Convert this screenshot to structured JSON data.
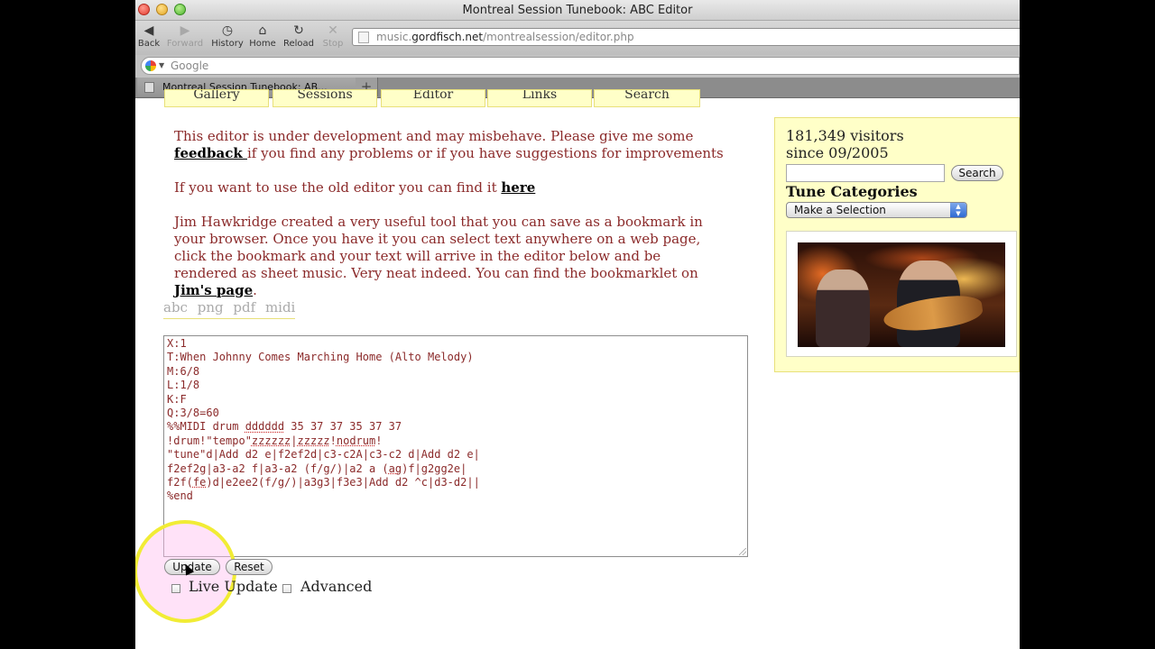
{
  "window": {
    "title": "Montreal Session Tunebook: ABC Editor"
  },
  "toolbar": {
    "back": "Back",
    "forward": "Forward",
    "history": "History",
    "home": "Home",
    "reload": "Reload",
    "stop": "Stop"
  },
  "address": {
    "prefix": "music.",
    "domain": "gordfisch.net",
    "path": "/montrealsession/editor.php"
  },
  "search_bar": {
    "placeholder": "Google"
  },
  "tabs": [
    {
      "label": "Montreal Session Tunebook: AB..."
    }
  ],
  "nav": {
    "gallery": "Gallery",
    "sessions": "Sessions",
    "editor": "Editor",
    "links": "Links",
    "search": "Search"
  },
  "intro": {
    "p1_text": "This editor is under development and may misbehave. Please give me some",
    "p1_link": "feedback ",
    "p1_tail": "if you find any problems or if you have suggestions for improvements",
    "p2_text": "If you want to use the old editor you can find it ",
    "p2_link": "here",
    "p3_text": "Jim Hawkridge created a very useful tool that you can save as a bookmark in your browser. Once you have it you can select text anywhere on a web page, click the bookmark and your text will arrive in the editor below and be rendered as sheet music. Very neat indeed. You can find the bookmarklet on ",
    "p3_link": "Jim's page",
    "p3_end": "."
  },
  "formats": [
    "abc",
    "png",
    "pdf",
    "midi"
  ],
  "abc_lines": [
    "X:1",
    "T:When Johnny Comes Marching Home (Alto Melody)",
    "M:6/8",
    "L:1/8",
    "K:F",
    "Q:3/8=60",
    "%%MIDI drum dddddd 35 37 37 35 37 37",
    "!drum!\"tempo\"zzzzzz|zzzzz!nodrum!",
    "\"tune\"d|Add d2 e|f2ef2d|c3-c2A|c3-c2 d|Add d2 e|",
    "f2ef2g|a3-a2 f|a3-a2 (f/g/)|a2 a (ag)f|g2gg2e|",
    "f2f(fe)d|e2ee2(f/g/)|a3g3|f3e3|Add d2 ^c|d3-d2||",
    "%end"
  ],
  "buttons": {
    "update": "Update",
    "reset": "Reset"
  },
  "options": {
    "live_update": "Live Update",
    "advanced": "Advanced"
  },
  "sidebar": {
    "visitors": "181,349 visitors",
    "since": "since 09/2005",
    "search_button": "Search",
    "categories_title": "Tune Categories",
    "select_value": "Make a Selection"
  },
  "colors": {
    "accent_text": "#8b2a2a",
    "panel_bg": "#ffffc8",
    "panel_border": "#e8e07a",
    "highlight_ring": "#f1ec35"
  }
}
